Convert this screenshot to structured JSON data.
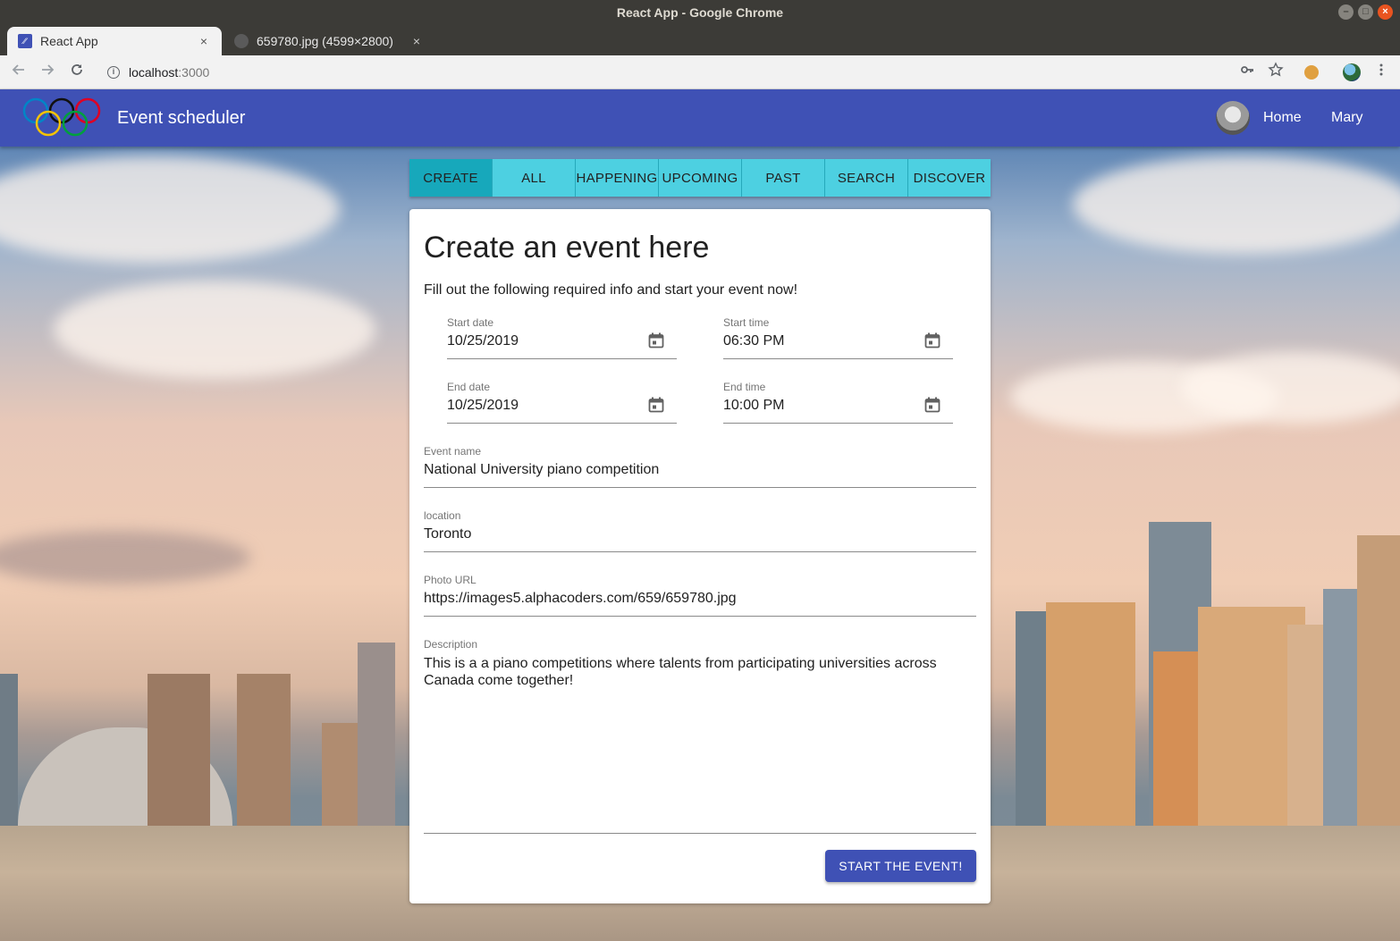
{
  "os": {
    "window_title": "React App - Google Chrome",
    "controls": [
      "–",
      "□",
      "×"
    ]
  },
  "browser": {
    "tabs": [
      {
        "title": "React App",
        "close": "×"
      },
      {
        "title": "659780.jpg (4599×2800)",
        "close": "×"
      }
    ],
    "new_tab": "+",
    "url_host": "localhost",
    "url_port": ":3000",
    "icons": [
      "back-icon",
      "forward-icon",
      "reload-icon",
      "info-icon",
      "key-icon",
      "star-icon",
      "cookie-icon",
      "profile-icon",
      "menu-icon"
    ]
  },
  "appbar": {
    "title": "Event scheduler",
    "nav": {
      "home": "Home",
      "user": "Mary"
    },
    "colors": {
      "primary": "#3f51b5"
    }
  },
  "tabs": {
    "items": [
      "CREATE",
      "ALL",
      "HAPPENING",
      "UPCOMING",
      "PAST",
      "SEARCH",
      "DISCOVER"
    ],
    "active": "CREATE",
    "colors": {
      "tab": "#4dd0e1",
      "active": "#17a8bb"
    }
  },
  "form": {
    "title": "Create an event here",
    "subtitle": "Fill out the following required info and start your event now!",
    "start_date": {
      "label": "Start date",
      "value": "10/25/2019"
    },
    "start_time": {
      "label": "Start time",
      "value": "06:30 PM"
    },
    "end_date": {
      "label": "End date",
      "value": "10/25/2019"
    },
    "end_time": {
      "label": "End time",
      "value": "10:00 PM"
    },
    "event_name": {
      "label": "Event name",
      "value": "National University piano competition"
    },
    "location": {
      "label": "location",
      "value": "Toronto"
    },
    "photo_url": {
      "label": "Photo URL",
      "value": "https://images5.alphacoders.com/659/659780.jpg"
    },
    "description": {
      "label": "Description",
      "value": "This is a a piano competitions where talents from participating universities across Canada come together!"
    },
    "submit": "START THE EVENT!"
  }
}
